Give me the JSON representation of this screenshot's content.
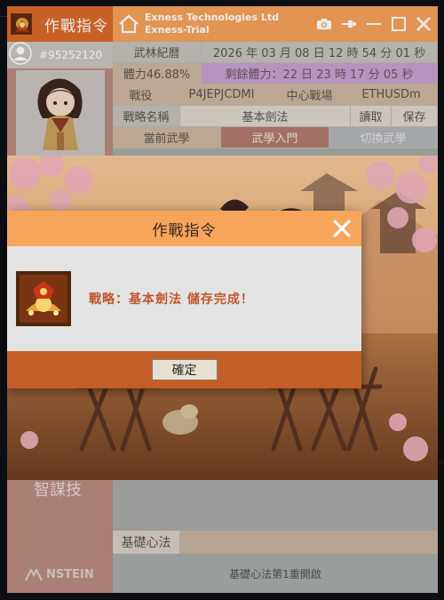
{
  "window": {
    "title": "作戰指令",
    "company": "Exness Technologies Ltd",
    "server": "Exness-Trial"
  },
  "sidebar": {
    "account_id": "#95252120",
    "skill_label": "智謀技",
    "brand": "NSTEIN"
  },
  "info": {
    "row1": {
      "label": "武林紀曆",
      "datetime": "2026 年 03 月 08 日 12 時 54 分 01 秒"
    },
    "row2": {
      "stamina": "體力46.88%",
      "remaining": "剩餘體力：22 日 23 時 17 分 05 秒"
    },
    "row3": {
      "battle_label": "戰役",
      "battle_value": "P4JEPJCDMI",
      "arena_label": "中心戰場",
      "symbol": "ETHUSDm"
    },
    "row4": {
      "strategy_label": "戰略名稱",
      "strategy_value": "基本劍法",
      "load_label": "讀取",
      "save_label": "保存"
    },
    "row5": {
      "current_label": "當前武學",
      "intro_label": "武學入門",
      "switch_label": "切換武學"
    }
  },
  "bottom": {
    "base_label": "基礎心法",
    "base_status": "基礎心法第1重開啟"
  },
  "dialog": {
    "title": "作戰指令",
    "message": "戰略：基本劍法 儲存完成！",
    "ok_label": "確定"
  },
  "colors": {
    "title_orange": "#f6a15b",
    "dark_orange": "#c45e27",
    "message_red": "#c0562b",
    "sidebar_rose": "#b98a80"
  }
}
